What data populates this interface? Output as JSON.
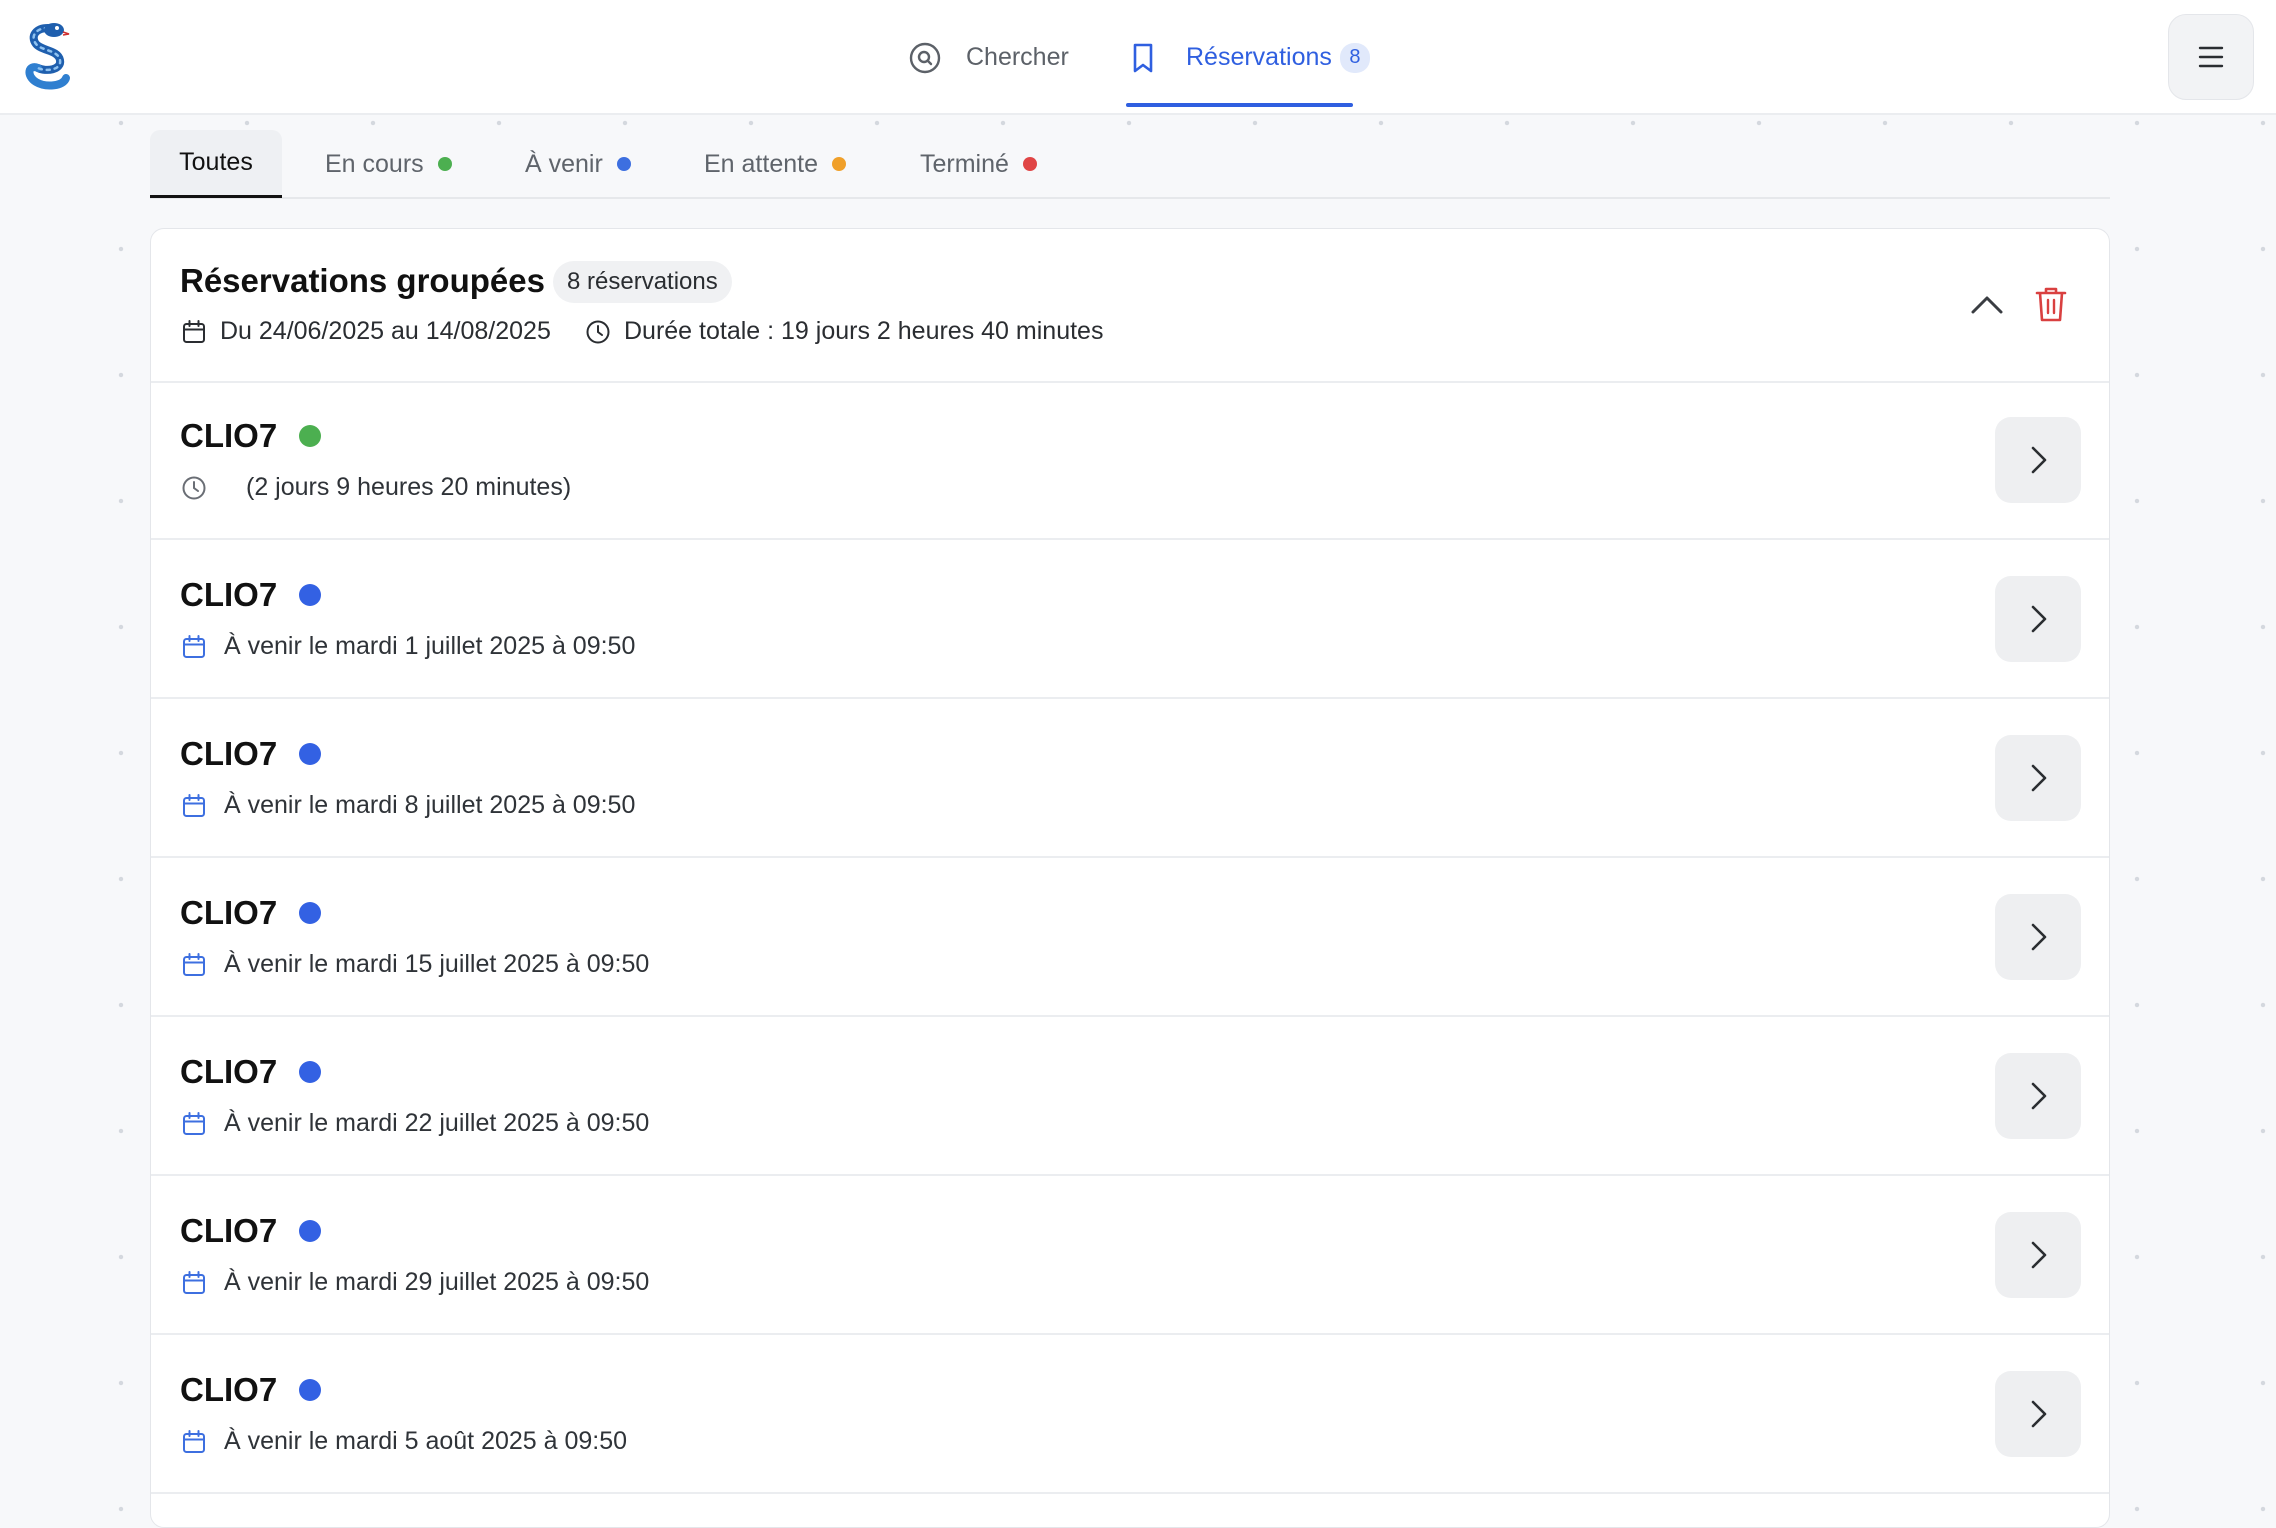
{
  "nav": {
    "search_label": "Chercher",
    "reservations_label": "Réservations",
    "reservations_count": "8"
  },
  "tabs": [
    {
      "label": "Toutes",
      "dot_color": null,
      "active": true
    },
    {
      "label": "En cours",
      "dot_color": "#4caf50"
    },
    {
      "label": "À venir",
      "dot_color": "#3d6fe0"
    },
    {
      "label": "En attente",
      "dot_color": "#f0a02a"
    },
    {
      "label": "Terminé",
      "dot_color": "#e04545"
    }
  ],
  "group": {
    "title": "Réservations groupées",
    "count": "8 réservations",
    "date_range": "Du 24/06/2025 au 14/08/2025",
    "total_duration": "Durée totale : 19 jours 2 heures 40 minutes"
  },
  "reservations": [
    {
      "name": "CLIO7",
      "status": "en-cours",
      "status_color": "#4caf50",
      "icon": "clock-icon",
      "detail": "(2 jours 9 heures 20 minutes)"
    },
    {
      "name": "CLIO7",
      "status": "a-venir",
      "status_color": "#3361e3",
      "icon": "calendar-icon",
      "detail": "À venir le mardi 1 juillet 2025 à 09:50"
    },
    {
      "name": "CLIO7",
      "status": "a-venir",
      "status_color": "#3361e3",
      "icon": "calendar-icon",
      "detail": "À venir le mardi 8 juillet 2025 à 09:50"
    },
    {
      "name": "CLIO7",
      "status": "a-venir",
      "status_color": "#3361e3",
      "icon": "calendar-icon",
      "detail": "À venir le mardi 15 juillet 2025 à 09:50"
    },
    {
      "name": "CLIO7",
      "status": "a-venir",
      "status_color": "#3361e3",
      "icon": "calendar-icon",
      "detail": "À venir le mardi 22 juillet 2025 à 09:50"
    },
    {
      "name": "CLIO7",
      "status": "a-venir",
      "status_color": "#3361e3",
      "icon": "calendar-icon",
      "detail": "À venir le mardi 29 juillet 2025 à 09:50"
    },
    {
      "name": "CLIO7",
      "status": "a-venir",
      "status_color": "#3361e3",
      "icon": "calendar-icon",
      "detail": "À venir le mardi 5 août 2025 à 09:50"
    }
  ]
}
